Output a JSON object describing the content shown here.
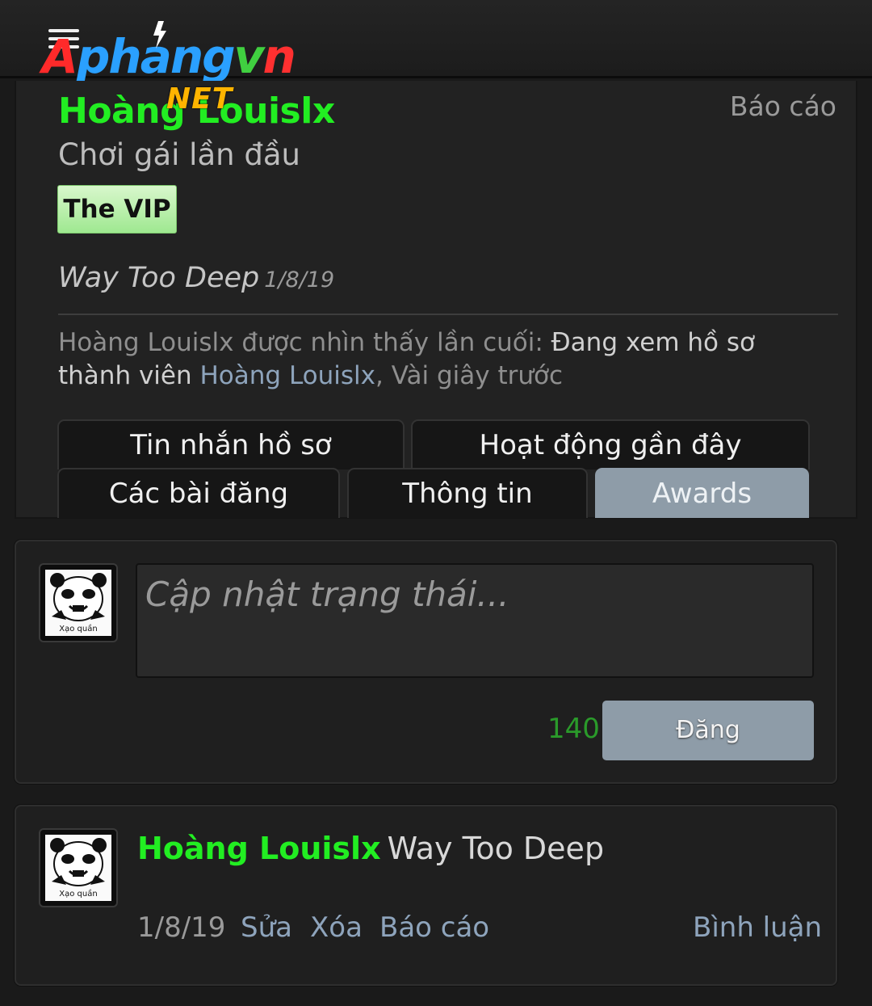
{
  "header": {
    "logo_text": "Aphangvn",
    "logo_suffix": "NET",
    "menu_icon": "hamburger-menu-icon"
  },
  "profile": {
    "username": "Hoàng Louislx",
    "report_label": "Báo cáo",
    "user_title": "Chơi gái lần đầu",
    "badge": "The VIP",
    "status": "Way Too Deep",
    "status_date": "1/8/19",
    "last_seen_prefix": "Hoàng Louislx được nhìn thấy lần cuối:",
    "last_seen_activity": "Đang xem hồ sơ thành viên",
    "last_seen_member": "Hoàng Louislx",
    "last_seen_time": ", Vài giây trước"
  },
  "tabs": [
    {
      "label": "Tin nhắn hồ sơ",
      "active": false
    },
    {
      "label": "Hoạt động gần đây",
      "active": false
    },
    {
      "label": "Các bài đăng",
      "active": false
    },
    {
      "label": "Thông tin",
      "active": false
    },
    {
      "label": "Awards",
      "active": true
    }
  ],
  "composer": {
    "placeholder": "Cập nhật trạng thái...",
    "value": "",
    "char_counter": "140",
    "post_label": "Đăng"
  },
  "feed": {
    "name": "Hoàng Louislx",
    "message": "Way Too Deep",
    "date": "1/8/19",
    "edit_label": "Sửa",
    "delete_label": "Xóa",
    "report_label": "Báo cáo",
    "comment_label": "Bình luận"
  },
  "avatar_caption": "Xạo quần",
  "colors": {
    "accent_green": "#22ee22",
    "link_blue": "#8ea4bc",
    "active_tab": "#8e9ca8",
    "badge_green": "#9fe890"
  }
}
